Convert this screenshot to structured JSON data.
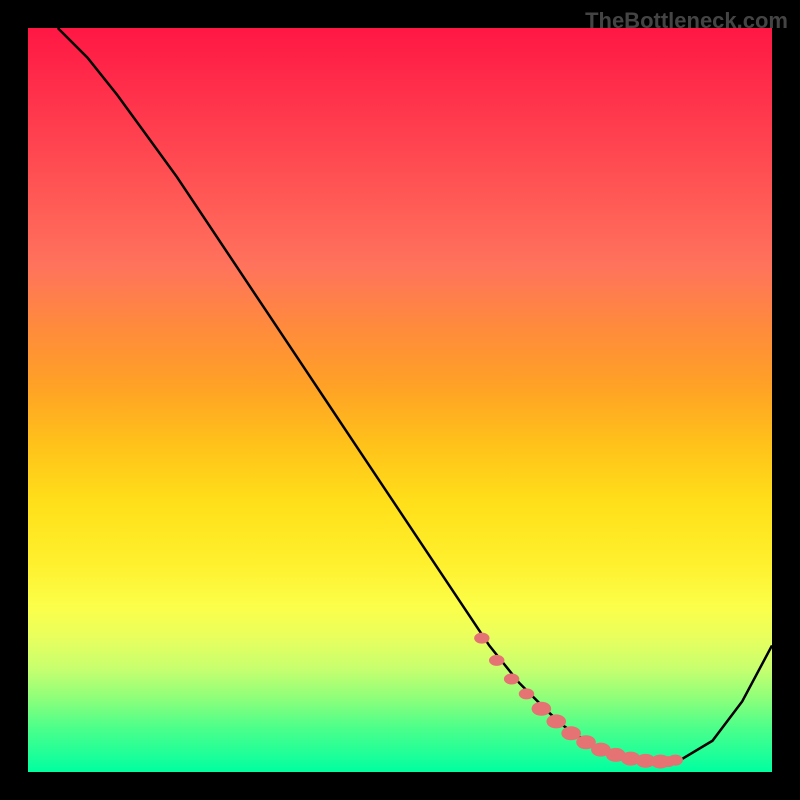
{
  "watermark": "TheBottleneck.com",
  "chart_data": {
    "type": "line",
    "title": "",
    "xlabel": "",
    "ylabel": "",
    "xlim": [
      0,
      100
    ],
    "ylim": [
      0,
      100
    ],
    "series": [
      {
        "name": "bottleneck-curve",
        "x": [
          4,
          8,
          12,
          16,
          20,
          24,
          28,
          32,
          36,
          40,
          44,
          48,
          52,
          56,
          60,
          62,
          64,
          66,
          68,
          70,
          72,
          74,
          76,
          78,
          80,
          82,
          84,
          86,
          88,
          92,
          96,
          100
        ],
        "y": [
          100,
          96,
          91,
          85.5,
          80,
          74,
          68,
          62,
          56,
          50,
          44,
          38,
          32,
          26,
          20,
          17,
          14.5,
          12,
          10,
          8,
          6.2,
          4.8,
          3.6,
          2.6,
          2.0,
          1.6,
          1.4,
          1.4,
          1.8,
          4.2,
          9.5,
          17
        ]
      }
    ],
    "markers": {
      "name": "highlighted-points",
      "x": [
        61,
        63,
        65,
        67,
        69,
        71,
        73,
        75,
        77,
        79,
        81,
        83,
        85,
        86,
        87
      ],
      "y": [
        18,
        15,
        12.5,
        10.5,
        8.5,
        6.8,
        5.2,
        4.0,
        3.0,
        2.3,
        1.8,
        1.5,
        1.4,
        1.4,
        1.6
      ],
      "color": "#e57373"
    },
    "gradient_colors": {
      "top": "#ff1744",
      "middle": "#ffeb3b",
      "bottom": "#00e676"
    }
  }
}
